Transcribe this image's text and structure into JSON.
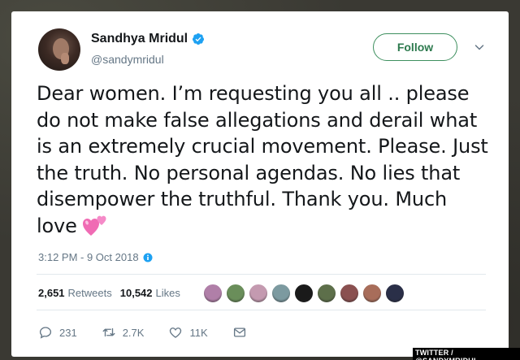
{
  "tweet": {
    "display_name": "Sandhya Mridul",
    "handle": "@sandymridul",
    "follow_label": "Follow",
    "text": "Dear women. I’m requesting you all .. please do not make false allegations and derail what is an extremely crucial movement. Please. Just the truth. No personal agendas. No lies that disempower the truthful. Thank you. Much love",
    "emoji_icon": "two-hearts-icon",
    "timestamp": "3:12 PM - 9 Oct 2018",
    "retweets_count": "2,651",
    "retweets_label": "Retweets",
    "likes_count": "10,542",
    "likes_label": "Likes",
    "replies": "231",
    "retweets_short": "2.7K",
    "likes_short": "11K"
  },
  "liker_avatars": [
    {
      "icon": "liker-avatar-icon",
      "color": "#b07fa8"
    },
    {
      "icon": "liker-avatar-icon",
      "color": "#6a8e5a"
    },
    {
      "icon": "liker-avatar-icon",
      "color": "#c49ab0"
    },
    {
      "icon": "liker-avatar-icon",
      "color": "#7c9aa0"
    },
    {
      "icon": "liker-avatar-icon",
      "color": "#1a1a1a"
    },
    {
      "icon": "liker-avatar-icon",
      "color": "#5d6f4a"
    },
    {
      "icon": "liker-avatar-icon",
      "color": "#8a5050"
    },
    {
      "icon": "liker-avatar-icon",
      "color": "#a86d5a"
    },
    {
      "icon": "liker-avatar-icon",
      "color": "#2a2f48"
    }
  ],
  "credit": "TWITTER / @SANDYMRIDUL",
  "colors": {
    "follow_accent": "#3d8f5e",
    "verified_blue": "#1da1f2",
    "text_primary": "#14171a",
    "text_secondary": "#657786",
    "heart_pink": "#f06bb4"
  }
}
